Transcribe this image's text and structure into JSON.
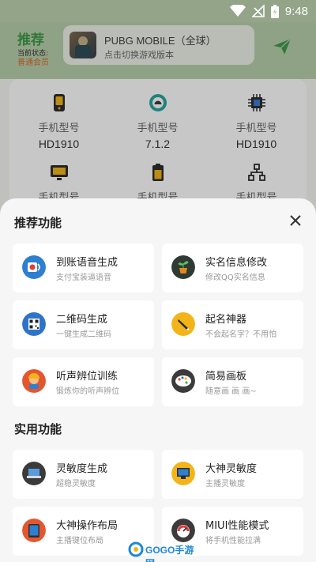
{
  "status_bar": {
    "time": "9:48"
  },
  "header": {
    "title": "推荐",
    "state_label": "当前状态:",
    "state_value": "普通会员",
    "game": {
      "title": "PUBG MOBILE（全球）",
      "subtitle": "点击切换游戏版本"
    }
  },
  "device_info": [
    {
      "label": "手机型号",
      "value": "HD1910",
      "icon": "phone-icon"
    },
    {
      "label": "手机型号",
      "value": "7.1.2",
      "icon": "android-icon"
    },
    {
      "label": "手机型号",
      "value": "HD1910",
      "icon": "chip-icon"
    },
    {
      "label": "手机型号",
      "value": "",
      "icon": "monitor-icon"
    },
    {
      "label": "手机型号",
      "value": "",
      "icon": "battery-icon"
    },
    {
      "label": "手机型号",
      "value": "",
      "icon": "network-icon"
    }
  ],
  "sheet": {
    "recommended_title": "推荐功能",
    "utility_title": "实用功能",
    "recommended": [
      {
        "title": "到账语音生成",
        "subtitle": "支付宝装逼语音",
        "icon": "payment-voice-icon",
        "color": "#2d7fd1"
      },
      {
        "title": "实名信息修改",
        "subtitle": "修改QQ实名信息",
        "icon": "plant-icon",
        "color": "#2e3a33"
      },
      {
        "title": "二维码生成",
        "subtitle": "一键生成二维码",
        "icon": "qrcode-icon",
        "color": "#2f73c8"
      },
      {
        "title": "起名神器",
        "subtitle": "不会起名字？不用怕",
        "icon": "pen-icon",
        "color": "#f2b418"
      },
      {
        "title": "听声辨位训练",
        "subtitle": "锻炼你的听声辨位",
        "icon": "soldier-icon",
        "color": "#e4572e"
      },
      {
        "title": "简易画板",
        "subtitle": "随意画 画 画~",
        "icon": "palette-icon",
        "color": "#3b3b3b"
      }
    ],
    "utility": [
      {
        "title": "灵敏度生成",
        "subtitle": "超稳灵敏度",
        "icon": "laptop-icon",
        "color": "#3b3b3b"
      },
      {
        "title": "大神灵敏度",
        "subtitle": "主播灵敏度",
        "icon": "desktop-icon",
        "color": "#f2b418"
      },
      {
        "title": "大神操作布局",
        "subtitle": "主播键位布局",
        "icon": "tablet-icon",
        "color": "#e4572e"
      },
      {
        "title": "MIUI性能模式",
        "subtitle": "将手机性能拉满",
        "icon": "gauge-icon",
        "color": "#3b3b3b"
      }
    ]
  },
  "watermark": {
    "text": "GOGO手游网"
  }
}
